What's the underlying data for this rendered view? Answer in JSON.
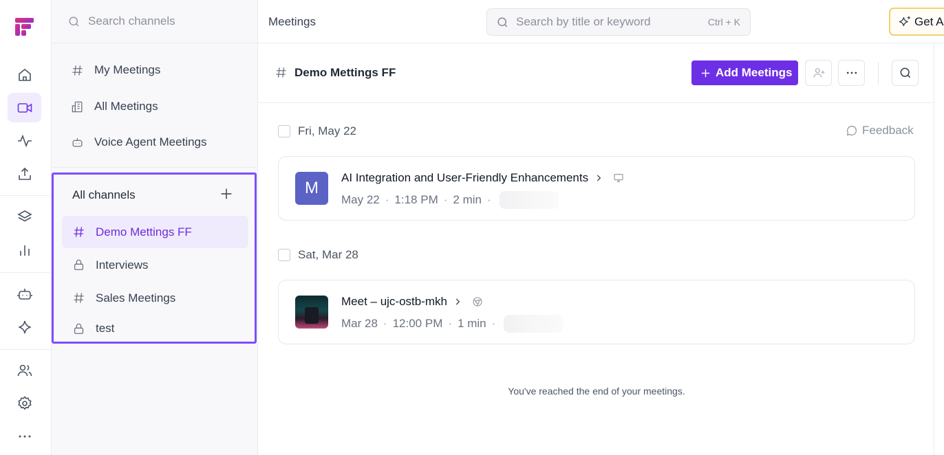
{
  "sidebar": {
    "search_placeholder": "Search channels",
    "nav": [
      {
        "label": "My Meetings",
        "icon": "hash-icon"
      },
      {
        "label": "All Meetings",
        "icon": "buildings-icon"
      },
      {
        "label": "Voice Agent Meetings",
        "icon": "bot-icon"
      }
    ],
    "channels_header": "All channels",
    "channels": [
      {
        "label": "Demo Mettings FF",
        "icon": "hash-icon",
        "active": true
      },
      {
        "label": "Interviews",
        "icon": "lock-icon"
      },
      {
        "label": "Sales Meetings",
        "icon": "hash-icon"
      },
      {
        "label": "test",
        "icon": "lock-icon"
      }
    ]
  },
  "topbar": {
    "title": "Meetings",
    "search_placeholder": "Search by title or keyword",
    "shortcut": "Ctrl + K",
    "get_button": "Get A"
  },
  "channel": {
    "name": "Demo Mettings FF",
    "add_button": "Add Meetings"
  },
  "groups": [
    {
      "date": "Fri, May 22",
      "meeting": {
        "avatar_letter": "M",
        "avatar_color": "#5b63c4",
        "title": "AI Integration and User-Friendly Enhancements",
        "source_icon": "monitor-icon",
        "date": "May 22",
        "time": "1:18 PM",
        "duration": "2 min"
      }
    },
    {
      "date": "Sat, Mar 28",
      "meeting": {
        "title": "Meet – ujc-ostb-mkh",
        "source_icon": "chrome-icon",
        "date": "Mar 28",
        "time": "12:00 PM",
        "duration": "1 min"
      }
    }
  ],
  "feedback_label": "Feedback",
  "end_message": "You've reached the end of your meetings.",
  "colors": {
    "accent": "#6d2fe6",
    "highlight_border": "#7c4dff",
    "active_bg": "#efebfd"
  }
}
